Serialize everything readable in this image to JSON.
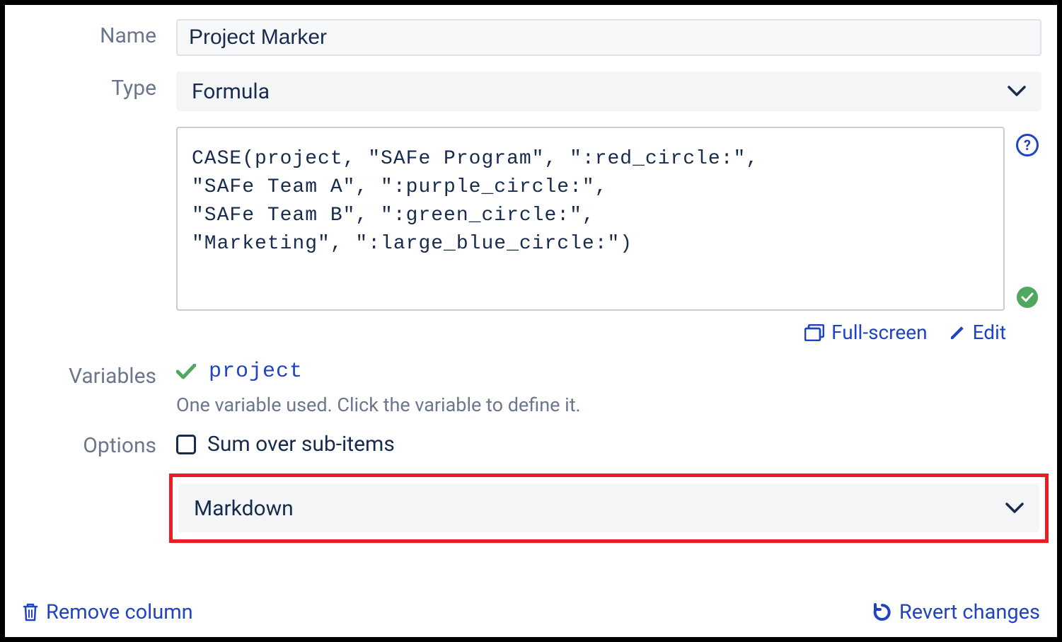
{
  "labels": {
    "name": "Name",
    "type": "Type",
    "variables": "Variables",
    "options": "Options"
  },
  "fields": {
    "name_value": "Project Marker",
    "type_value": "Formula",
    "formula": "CASE(project, \"SAFe Program\", \":red_circle:\",\n\"SAFe Team A\", \":purple_circle:\",\n\"SAFe Team B\", \":green_circle:\",\n\"Marketing\", \":large_blue_circle:\")"
  },
  "actions": {
    "fullscreen": "Full-screen",
    "edit": "Edit",
    "remove": "Remove column",
    "revert": "Revert changes"
  },
  "variables": {
    "name": "project",
    "help": "One variable used. Click the variable to define it."
  },
  "options": {
    "sum_label": "Sum over sub-items",
    "format_value": "Markdown"
  }
}
